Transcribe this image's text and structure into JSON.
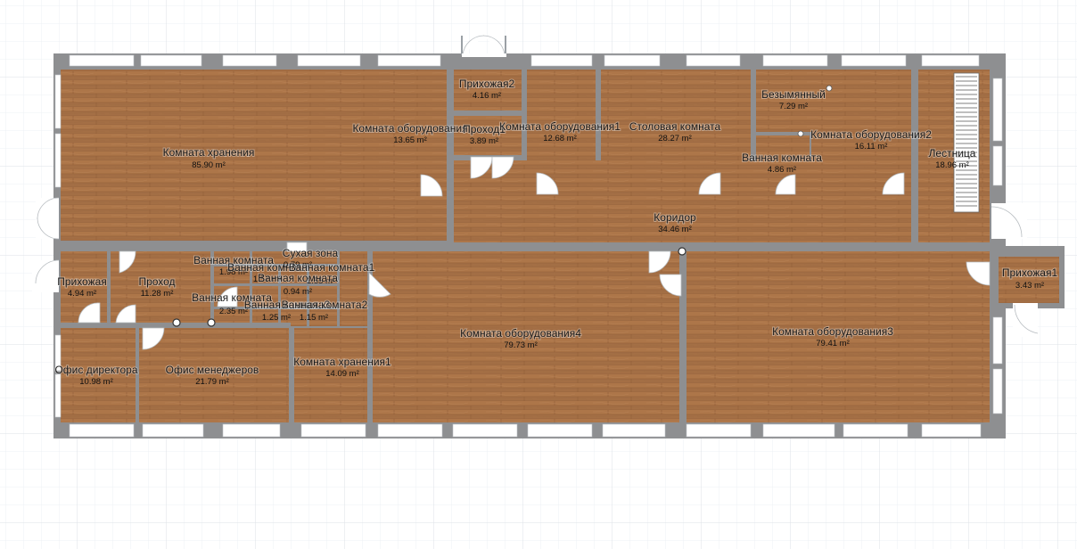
{
  "plan": {
    "units": "m²",
    "colors": {
      "grid_minor": "#eef1f4",
      "grid_major": "#dde2e7",
      "wall": "#8e8f91",
      "floor": "#a46f45",
      "floor_light": "#b98558",
      "window": "#ffffff",
      "door_fill": "#ffffff"
    },
    "rooms": {
      "storage": {
        "name": "Комната хранения",
        "area": "85.90 m²"
      },
      "equip_left": {
        "name": "Комната оборудования",
        "area": "13.65 m²"
      },
      "hall2": {
        "name": "Прихожая2",
        "area": "4.16 m²"
      },
      "pass1": {
        "name": "Проход1",
        "area": "3.89 m²"
      },
      "equip1": {
        "name": "Комната оборудования1",
        "area": "12.68 m²"
      },
      "dining": {
        "name": "Столовая комната",
        "area": "28.27 m²"
      },
      "unnamed": {
        "name": "Безымянный",
        "area": "7.29 m²"
      },
      "equip2": {
        "name": "Комната оборудования2",
        "area": "16.11 m²"
      },
      "bath_top": {
        "name": "Ванная комната",
        "area": "4.86 m²"
      },
      "stairs": {
        "name": "Лестница",
        "area": "18.96 m²"
      },
      "corridor": {
        "name": "Коридор",
        "area": "34.46 m²"
      },
      "hall_left": {
        "name": "Прихожая",
        "area": "4.94 m²"
      },
      "pass": {
        "name": "Проход",
        "area": "11.28 m²"
      },
      "bath_a": {
        "name": "Ванная комната",
        "area": "1.98 m²"
      },
      "bath_b": {
        "name": "Ванная комната",
        "area": "1.57 m²"
      },
      "dry_zone": {
        "name": "Сухая зона",
        "area": "0.79 m²"
      },
      "bath1": {
        "name": "Ванная комната1",
        "area": "1.55 m²"
      },
      "bath_c": {
        "name": "Ванная комната",
        "area": "0.94 m²"
      },
      "bath_d": {
        "name": "Ванная комната",
        "area": "2.35 m²"
      },
      "bath3": {
        "name": "Ванная комната3",
        "area": "1.25 m²"
      },
      "bath2": {
        "name": "Ванная комната2",
        "area": "1.15 m²"
      },
      "director": {
        "name": "Офис директора",
        "area": "10.98 m²"
      },
      "managers": {
        "name": "Офис менеджеров",
        "area": "21.79 m²"
      },
      "storage1": {
        "name": "Комната хранения1",
        "area": "14.09 m²"
      },
      "equip4": {
        "name": "Комната оборудования4",
        "area": "79.73 m²"
      },
      "equip3": {
        "name": "Комната оборудования3",
        "area": "79.41 m²"
      },
      "hall1": {
        "name": "Прихожая1",
        "area": "3.43 m²"
      }
    }
  }
}
